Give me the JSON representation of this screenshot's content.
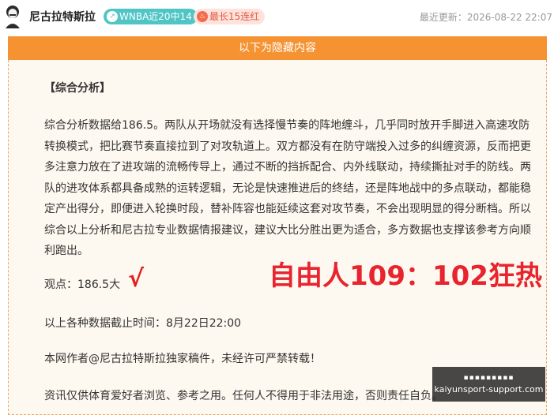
{
  "header": {
    "author_name": "尼古拉特斯拉",
    "badge_wnba": "WNBA近20中14",
    "badge_streak": "最长15连红",
    "last_update": "最近更新：2026-08-22 22:07"
  },
  "banner": {
    "text": "以下为隐藏内容"
  },
  "article": {
    "section_title": "【综合分析】",
    "paragraph": "综合分析数据给186.5。两队从开场就没有选择慢节奏的阵地缠斗，几乎同时放开手脚进入高速攻防转换模式，把比赛节奏直接拉到了对攻轨道上。双方都没有在防守端投入过多的纠缠资源，反而把更多注意力放在了进攻端的流畅传导上，通过不断的挡拆配合、内外线联动，持续撕扯对手的防线。两队的进攻体系都具备成熟的运转逻辑，无论是快速推进后的终结，还是阵地战中的多点联动，都能稳定产出得分，即便进入轮换时段，替补阵容也能延续这套对攻节奏，不会出现明显的得分断档。所以综合以上分析和尼古拉专业数据情报建议，建议大比分胜出更为适合，多方数据也支撑该参考方向顺利跑出。",
    "viewpoint": "观点：186.5大",
    "checkmark": "√",
    "result_overlay": "自由人109：102狂热",
    "cutoff": "以上各种数据截止时间：8月22日22:00",
    "copyright": "本网作者@尼古拉特斯拉独家稿件，未经许可严禁转载！",
    "disclaimer": "资讯仅供体育爱好者浏览、参考之用。任何人不得用于非法用途，否则责任自负。"
  },
  "watermark": {
    "top_text": "▪▪▪▪▪▪▪▪▪",
    "url": "kaiyunsport-support.com"
  },
  "colors": {
    "banner_orange": "#f59232",
    "accent_red": "#e8242e",
    "wnba_teal": "#50c5c5",
    "card_bg": "#fef9f0"
  }
}
